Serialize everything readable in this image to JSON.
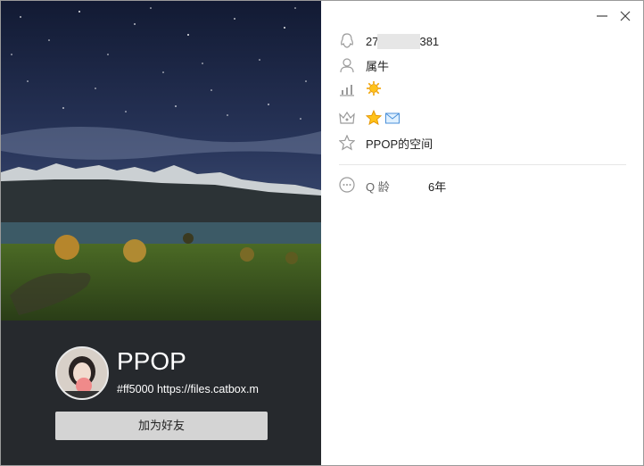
{
  "profile": {
    "nickname": "PPOP",
    "signature": "#ff5000 https://files.catbox.m",
    "add_friend_label": "加为好友"
  },
  "info": {
    "qq_prefix": "27",
    "qq_suffix": "381",
    "zodiac": "属牛",
    "space_link": "PPOP的空间",
    "qage_label": "Q 龄",
    "qage_value": "6年"
  },
  "icons": {
    "qq": "penguin-icon",
    "user": "user-icon",
    "level": "bar-chart-icon",
    "sun_badge": "sun-icon",
    "vip": "crown-icon",
    "star_badge": "star-badge-icon",
    "mail_badge": "mail-icon",
    "space": "star-icon",
    "more": "more-icon"
  },
  "colors": {
    "profile_bg": "#26292d",
    "button_bg": "#d4d4d4",
    "icon_gray": "#9a9a9a"
  }
}
